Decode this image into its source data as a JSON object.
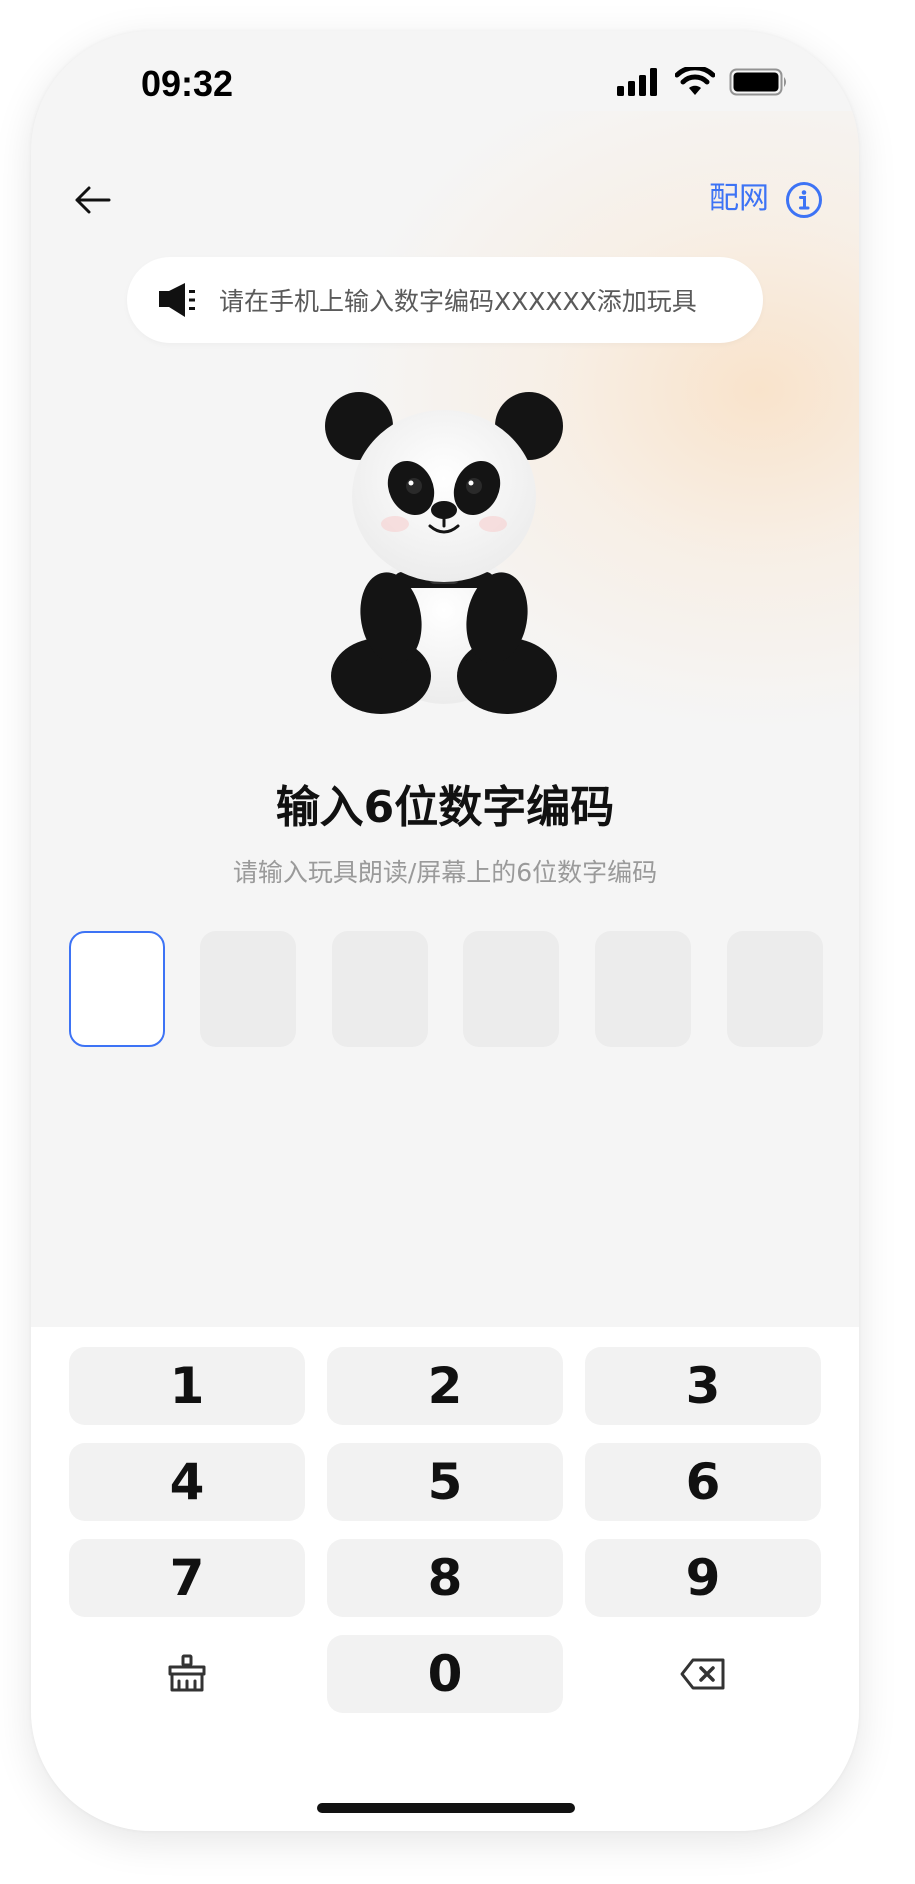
{
  "status_bar": {
    "time": "09:32"
  },
  "header": {
    "network_link": "配网"
  },
  "notice": {
    "text": "请在手机上输入数字编码XXXXXX添加玩具"
  },
  "main": {
    "title": "输入6位数字编码",
    "subtitle": "请输入玩具朗读/屏幕上的6位数字编码",
    "code_digits": [
      "",
      "",
      "",
      "",
      "",
      ""
    ],
    "active_box_index": 0
  },
  "keypad": {
    "keys": [
      "1",
      "2",
      "3",
      "4",
      "5",
      "6",
      "7",
      "8",
      "9",
      "0"
    ],
    "clear_icon": "broom-icon",
    "backspace_icon": "backspace-icon"
  },
  "colors": {
    "accent": "#3d73f5",
    "background": "#f5f5f5",
    "key_bg": "#f2f2f2",
    "code_box_bg": "#ececec"
  }
}
